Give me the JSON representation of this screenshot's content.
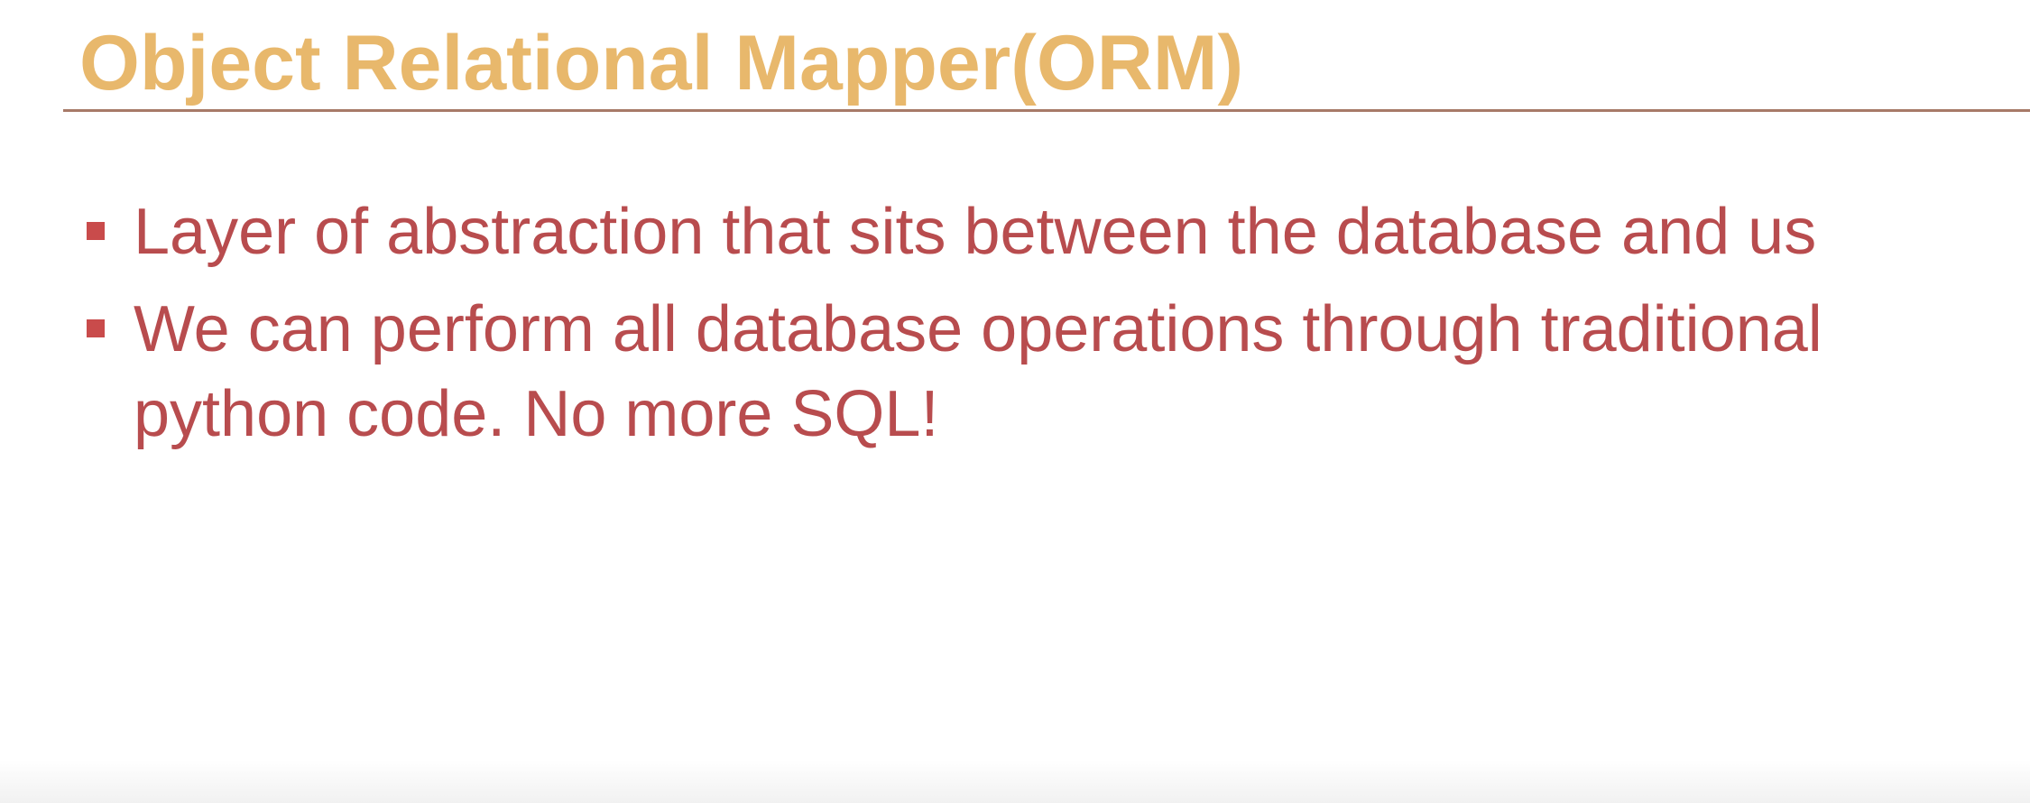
{
  "slide": {
    "title": "Object Relational Mapper(ORM)",
    "bullets": [
      {
        "text": "Layer of abstraction that sits between the database and us"
      },
      {
        "text": "We can perform all database operations through traditional python code. No more SQL!"
      }
    ]
  },
  "colors": {
    "title": "#e8b86c",
    "body_text": "#b84c4e",
    "bullet_marker": "#c94b4b",
    "rule": "#a77a68",
    "background": "#ffffff"
  }
}
